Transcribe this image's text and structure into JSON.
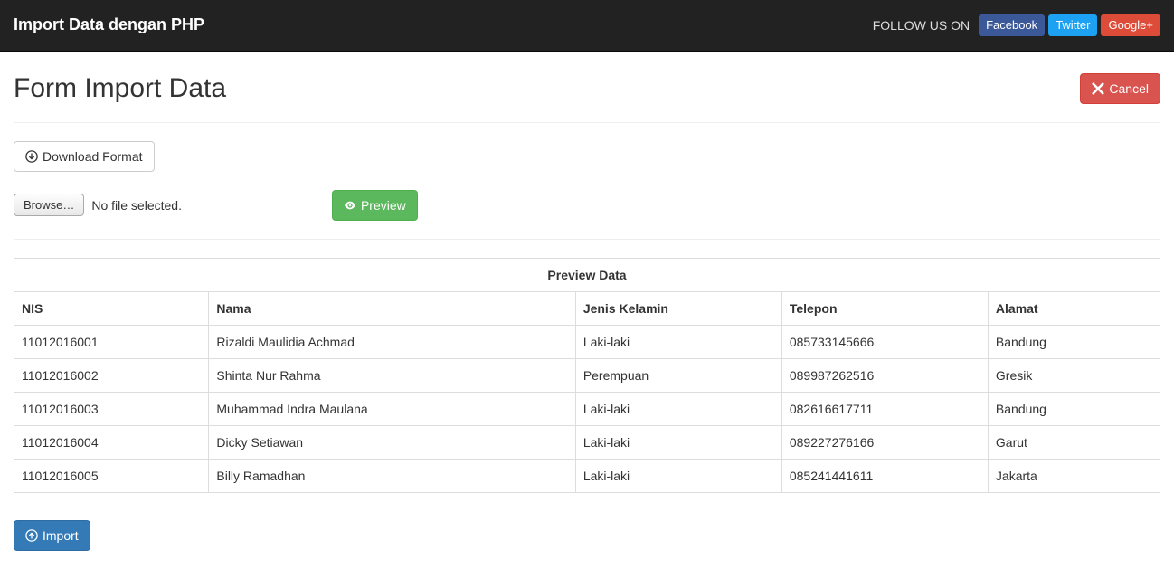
{
  "navbar": {
    "brand": "Import Data dengan PHP",
    "follow_text": "FOLLOW US ON",
    "social": {
      "facebook": "Facebook",
      "twitter": "Twitter",
      "google": "Google+"
    }
  },
  "page": {
    "title": "Form Import Data",
    "cancel_label": "Cancel",
    "download_label": "Download Format",
    "browse_label": "Browse…",
    "no_file_label": "No file selected.",
    "preview_label": "Preview",
    "import_label": "Import"
  },
  "table": {
    "title": "Preview Data",
    "headers": {
      "nis": "NIS",
      "nama": "Nama",
      "jk": "Jenis Kelamin",
      "telepon": "Telepon",
      "alamat": "Alamat"
    },
    "rows": [
      {
        "nis": "11012016001",
        "nama": "Rizaldi Maulidia Achmad",
        "jk": "Laki-laki",
        "telepon": "085733145666",
        "alamat": "Bandung"
      },
      {
        "nis": "11012016002",
        "nama": "Shinta Nur Rahma",
        "jk": "Perempuan",
        "telepon": "089987262516",
        "alamat": "Gresik"
      },
      {
        "nis": "11012016003",
        "nama": "Muhammad Indra Maulana",
        "jk": "Laki-laki",
        "telepon": "082616617711",
        "alamat": "Bandung"
      },
      {
        "nis": "11012016004",
        "nama": "Dicky Setiawan",
        "jk": "Laki-laki",
        "telepon": "089227276166",
        "alamat": "Garut"
      },
      {
        "nis": "11012016005",
        "nama": "Billy Ramadhan",
        "jk": "Laki-laki",
        "telepon": "085241441611",
        "alamat": "Jakarta"
      }
    ]
  }
}
